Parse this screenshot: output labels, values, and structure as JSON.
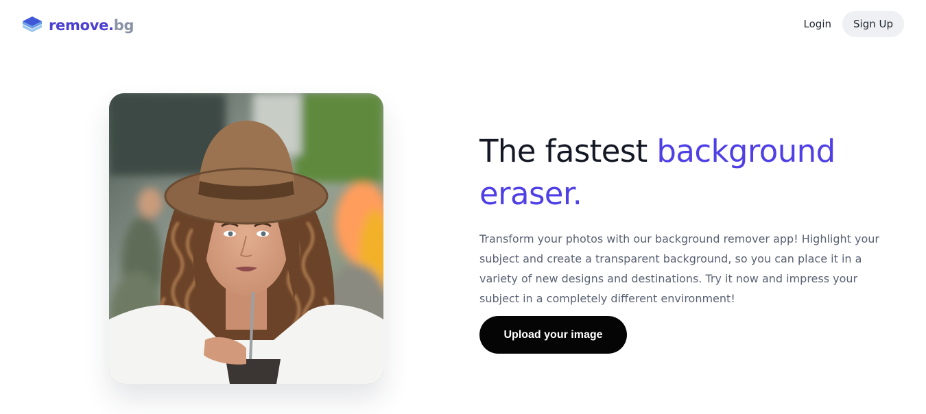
{
  "header": {
    "logo": {
      "brand_main": "remove.",
      "brand_tld": "bg",
      "icon": "layers-icon"
    },
    "nav": {
      "login_label": "Login",
      "signup_label": "Sign Up"
    }
  },
  "hero": {
    "image": {
      "alt": "Woman with curly hair wearing a hat, holding a drink"
    },
    "headline_part1": "The fastest ",
    "headline_accent": "background eraser.",
    "description": "Transform your photos with our background remover app! Highlight your subject and create a transparent background, so you can place it in a variety of new designs and destinations. Try it now and impress your subject in a completely different environment!",
    "upload_button_label": "Upload your image"
  },
  "colors": {
    "brand_primary": "#4a3fd1",
    "brand_secondary": "#8a93a6",
    "accent": "#4f3fe6",
    "headline": "#141824",
    "body_text": "#5a6273",
    "button_bg": "#050505",
    "signup_bg": "#eef0f3"
  }
}
